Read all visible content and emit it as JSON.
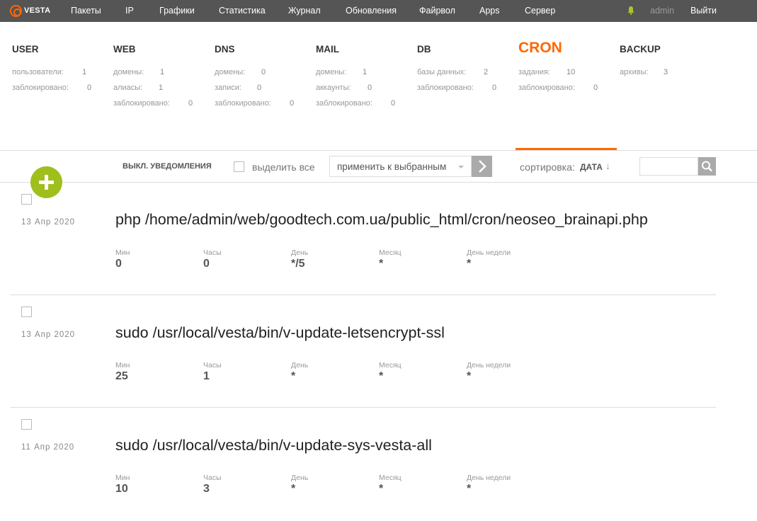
{
  "brand": {
    "name": "VESTA",
    "accent": "#ff6701"
  },
  "nav": {
    "items": [
      "Пакеты",
      "IP",
      "Графики",
      "Статистика",
      "Журнал",
      "Обновления",
      "Файрвол",
      "Apps",
      "Сервер"
    ],
    "bell_icon": "bell-icon",
    "user": "admin",
    "logout": "Выйти"
  },
  "stats": {
    "user": {
      "title": "USER",
      "rows": [
        [
          "пользователи:",
          "1"
        ],
        [
          "заблокировано:",
          "0"
        ]
      ]
    },
    "web": {
      "title": "WEB",
      "rows": [
        [
          "домены:",
          "1"
        ],
        [
          "алиасы:",
          "1"
        ],
        [
          "заблокировано:",
          "0"
        ]
      ]
    },
    "dns": {
      "title": "DNS",
      "rows": [
        [
          "домены:",
          "0"
        ],
        [
          "записи:",
          "0"
        ],
        [
          "заблокировано:",
          "0"
        ]
      ]
    },
    "mail": {
      "title": "MAIL",
      "rows": [
        [
          "домены:",
          "1"
        ],
        [
          "аккаунты:",
          "0"
        ],
        [
          "заблокировано:",
          "0"
        ]
      ]
    },
    "db": {
      "title": "DB",
      "rows": [
        [
          "базы данных:",
          "2"
        ],
        [
          "заблокировано:",
          "0"
        ]
      ]
    },
    "cron": {
      "title": "CRON",
      "rows": [
        [
          "задания:",
          "10"
        ],
        [
          "заблокировано:",
          "0"
        ]
      ]
    },
    "backup": {
      "title": "BACKUP",
      "rows": [
        [
          "архивы:",
          "3"
        ]
      ]
    }
  },
  "toolbar": {
    "mute_notifications": "ВЫКЛ. УВЕДОМЛЕНИЯ",
    "select_all": "выделить все",
    "apply_selected": "применить к выбранным",
    "sort_label": "сортировка:",
    "sort_value": "ДАТА",
    "sort_arrow": "↓",
    "search_placeholder": ""
  },
  "field_labels": {
    "min": "Мин",
    "hour": "Часы",
    "day": "День",
    "month": "Месяц",
    "weekday": "День недели"
  },
  "jobs": [
    {
      "date": "13 Апр 2020",
      "command": "php /home/admin/web/goodtech.com.ua/public_html/cron/neoseo_brainapi.php",
      "min": "0",
      "hour": "0",
      "day": "*/5",
      "month": "*",
      "weekday": "*"
    },
    {
      "date": "13 Апр 2020",
      "command": "sudo /usr/local/vesta/bin/v-update-letsencrypt-ssl",
      "min": "25",
      "hour": "1",
      "day": "*",
      "month": "*",
      "weekday": "*"
    },
    {
      "date": "11 Апр 2020",
      "command": "sudo /usr/local/vesta/bin/v-update-sys-vesta-all",
      "min": "10",
      "hour": "3",
      "day": "*",
      "month": "*",
      "weekday": "*"
    }
  ]
}
